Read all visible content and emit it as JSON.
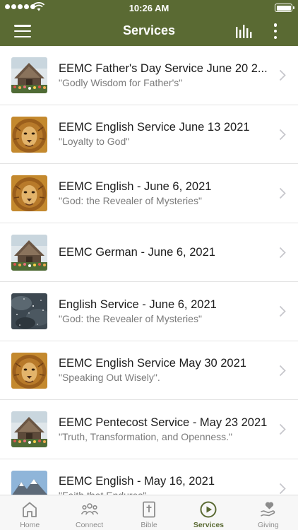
{
  "status_bar": {
    "time": "10:26 AM",
    "signal_icon": "cellular-signal-icon",
    "wifi_icon": "wifi-icon",
    "battery_icon": "battery-icon",
    "battery_level": 1.0
  },
  "nav": {
    "title": "Services",
    "menu_icon": "hamburger-menu-icon",
    "audio_icon": "audio-bars-icon",
    "more_icon": "more-vertical-icon"
  },
  "colors": {
    "header": "#5a6a33",
    "accent": "#5a6a33",
    "tab_inactive": "#8c8c8c"
  },
  "services": [
    {
      "title": "EEMC Father's Day Service June 20 2...",
      "subtitle": "\"Godly Wisdom for Father's\"",
      "thumbnail": "church-photo"
    },
    {
      "title": "EEMC English Service June 13 2021",
      "subtitle": "\"Loyalty to God\"",
      "thumbnail": "lion-painting"
    },
    {
      "title": "EEMC English - June 6, 2021",
      "subtitle": "\"God: the Revealer of Mysteries\"",
      "thumbnail": "lion-painting"
    },
    {
      "title": "EEMC German - June 6, 2021",
      "subtitle": "",
      "thumbnail": "church-photo"
    },
    {
      "title": "English Service - June 6, 2021",
      "subtitle": "\"God: the Revealer of Mysteries\"",
      "thumbnail": "night-sky-photo"
    },
    {
      "title": "EEMC English Service May 30 2021",
      "subtitle": "\"Speaking Out Wisely\".",
      "thumbnail": "lion-painting"
    },
    {
      "title": "EEMC Pentecost Service - May 23 2021",
      "subtitle": "\"Truth, Transformation, and Openness.\"",
      "thumbnail": "church-photo"
    },
    {
      "title": "EEMC English - May 16, 2021",
      "subtitle": "\"Faith that Endures\"",
      "thumbnail": "mountain-photo"
    }
  ],
  "tabs": [
    {
      "label": "Home",
      "icon": "home-icon",
      "active": false
    },
    {
      "label": "Connect",
      "icon": "people-group-icon",
      "active": false
    },
    {
      "label": "Bible",
      "icon": "bible-cross-icon",
      "active": false
    },
    {
      "label": "Services",
      "icon": "play-circle-icon",
      "active": true
    },
    {
      "label": "Giving",
      "icon": "giving-hand-heart-icon",
      "active": false
    }
  ]
}
